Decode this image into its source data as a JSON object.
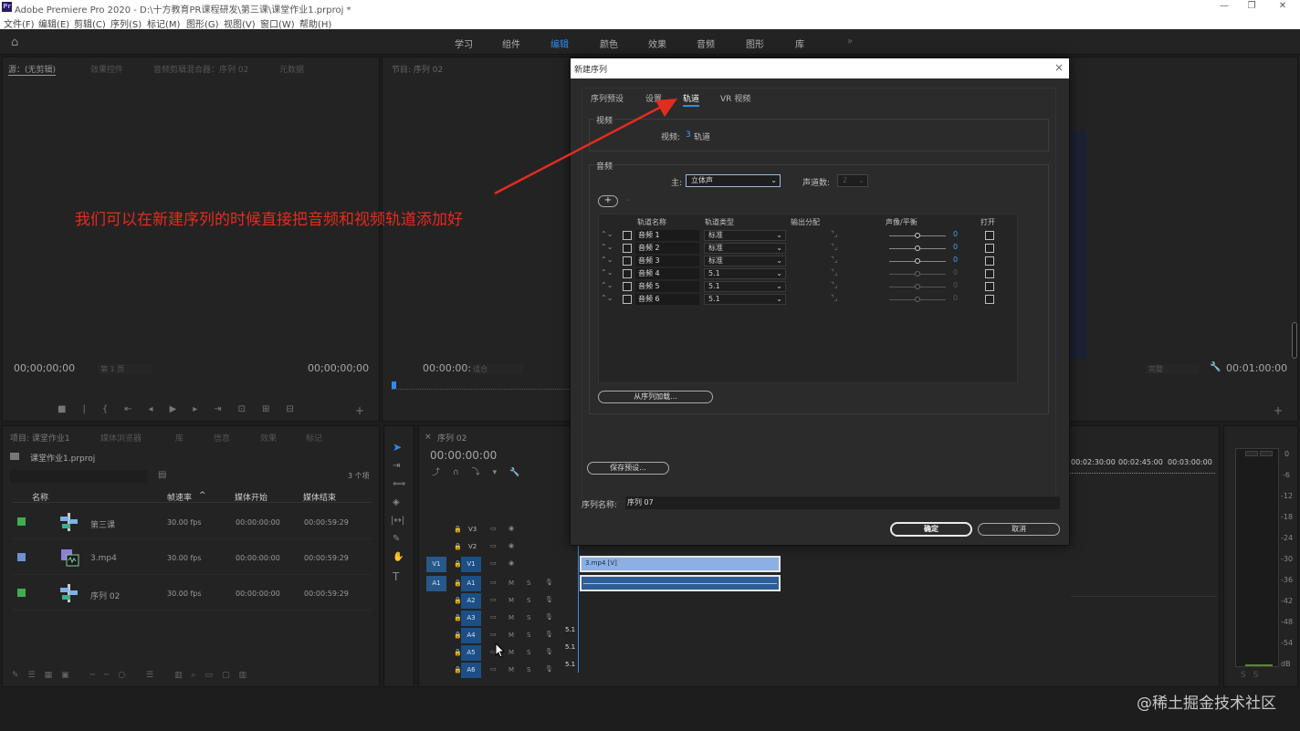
{
  "app": {
    "window_title": "Adobe Premiere Pro 2020 - D:\\十方教育PR课程研发\\第三课\\课堂作业1.prproj *",
    "icon_text": "Pr",
    "menu": [
      "文件(F)",
      "编辑(E)",
      "剪辑(C)",
      "序列(S)",
      "标记(M)",
      "图形(G)",
      "视图(V)",
      "窗口(W)",
      "帮助(H)"
    ]
  },
  "workspaces": {
    "tabs": [
      "学习",
      "组件",
      "编辑",
      "颜色",
      "效果",
      "音频",
      "图形",
      "库"
    ],
    "active": "编辑",
    "more": "»"
  },
  "source_panel": {
    "tabs": [
      "源：(无剪辑)",
      "效果控件",
      "音频剪辑混合器：序列 02",
      "元数据"
    ],
    "tc_left": "00;00;00;00",
    "fit": "第 1 页",
    "tc_right": "00;00;00;00"
  },
  "program_panel": {
    "tab": "节目: 序列 02",
    "tc_left": "00:00:00:00",
    "fit": "适合",
    "quality": "完整",
    "tc_right": "00:01:00:00"
  },
  "project_panel": {
    "tabs": [
      "项目: 课堂作业1",
      "媒体浏览器",
      "库",
      "信息",
      "效果",
      "标记"
    ],
    "file": "课堂作业1.prproj",
    "count": "3 个项",
    "columns": [
      "名称",
      "帧速率",
      "媒体开始",
      "媒体结束"
    ],
    "sort_indicator": "^",
    "items": [
      {
        "name": "第三课",
        "fps": "30.00 fps",
        "start": "00:00:00:00",
        "end": "00:00:59:29",
        "color": "#3fae4e"
      },
      {
        "name": "3.mp4",
        "fps": "30.00 fps",
        "start": "00:00:00:00",
        "end": "00:00:59:29",
        "color": "#6f8fd6"
      },
      {
        "name": "序列 02",
        "fps": "30.00 fps",
        "start": "00:00:00:00",
        "end": "00:00:59:29",
        "color": "#3fae4e"
      }
    ]
  },
  "timeline": {
    "tab": "序列 02",
    "tc": "00:00:00:00",
    "ruler": [
      "00:02:30:00",
      "00:02:45:00",
      "00:03:00:00"
    ],
    "video_tracks": [
      "V3",
      "V2",
      "V1"
    ],
    "audio_tracks": [
      "A1",
      "A2",
      "A3",
      "A4",
      "A5",
      "A6"
    ],
    "source_v": "V1",
    "source_a": "A1",
    "clip_label": "3.mp4 [V]",
    "channel_labels": [
      "5.1",
      "5.1",
      "5.1"
    ]
  },
  "meter": {
    "labels": [
      "0",
      "-6",
      "-12",
      "-18",
      "-24",
      "-30",
      "-36",
      "-42",
      "-48",
      "-54",
      "dB"
    ]
  },
  "dialog": {
    "title": "新建序列",
    "tabs": [
      "序列预设",
      "设置",
      "轨道",
      "VR 视频"
    ],
    "active_tab": "轨道",
    "video_section": "视频",
    "video_label": "视频:",
    "video_count": "3",
    "video_unit": "轨道",
    "audio_section": "音频",
    "master_label": "主:",
    "master_value": "立体声",
    "channels_label": "声道数:",
    "channels_value": "2",
    "add_button": "+",
    "remove_button": "-",
    "columns": [
      "轨道名称",
      "轨道类型",
      "输出分配",
      "声像/平衡",
      "打开"
    ],
    "tracks": [
      {
        "name": "音频 1",
        "type": "标准",
        "pan": "0"
      },
      {
        "name": "音频 2",
        "type": "标准",
        "pan": "0"
      },
      {
        "name": "音频 3",
        "type": "标准",
        "pan": "0"
      },
      {
        "name": "音频 4",
        "type": "5.1",
        "pan": "0"
      },
      {
        "name": "音频 5",
        "type": "5.1",
        "pan": "0"
      },
      {
        "name": "音频 6",
        "type": "5.1",
        "pan": "0"
      }
    ],
    "load_from_sequence": "从序列加载...",
    "save_preset": "保存预设...",
    "sequence_name_label": "序列名称:",
    "sequence_name": "序列 07",
    "ok": "确定",
    "cancel": "取消"
  },
  "annotation": {
    "text": "我们可以在新建序列的时候直接把音频和视频轨道添加好",
    "color": "#e52b1f"
  },
  "watermark": "@稀土掘金技术社区"
}
